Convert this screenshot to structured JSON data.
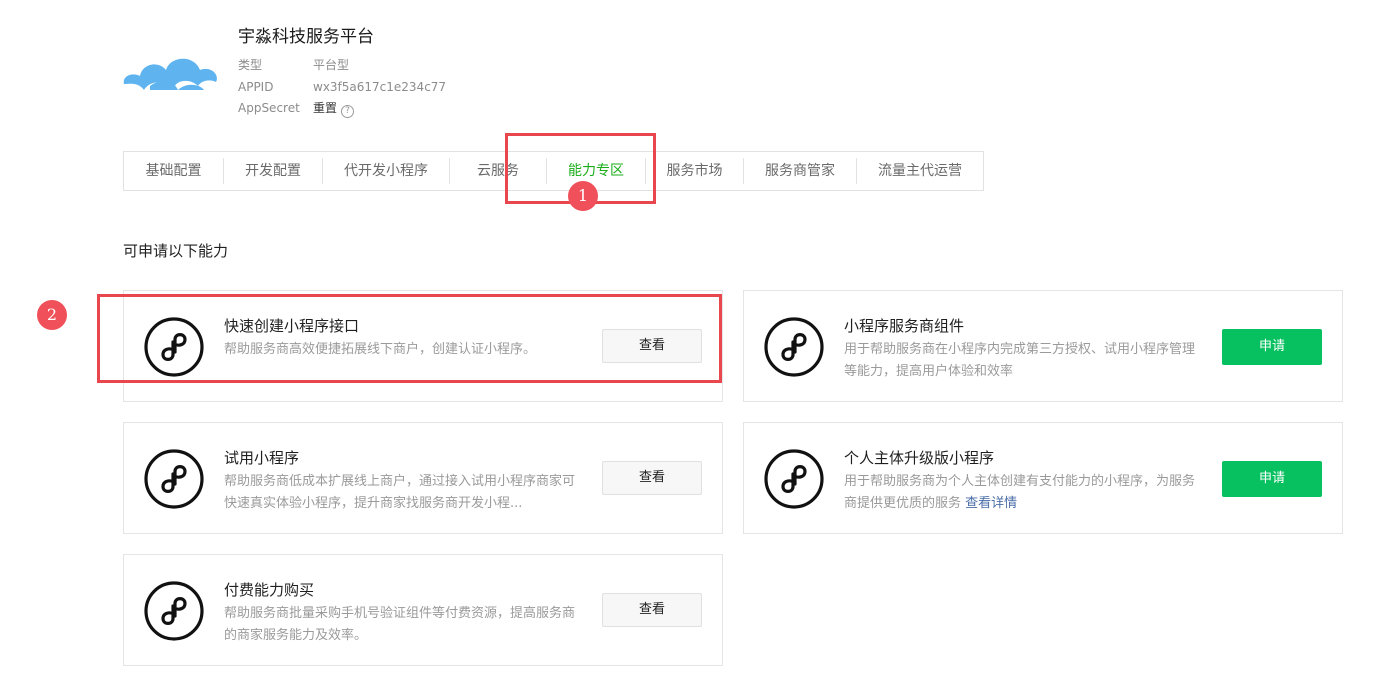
{
  "account": {
    "name": "宇淼科技服务平台",
    "type_label": "类型",
    "type_value": "平台型",
    "appid_label": "APPID",
    "appid_value": "wx3f5a617c1e234c77",
    "secret_label": "AppSecret",
    "secret_action": "重置",
    "help_glyph": "?"
  },
  "tabs": [
    {
      "label": "基础配置",
      "active": false
    },
    {
      "label": "开发配置",
      "active": false
    },
    {
      "label": "代开发小程序",
      "active": false
    },
    {
      "label": "云服务",
      "active": false
    },
    {
      "label": "能力专区",
      "active": true
    },
    {
      "label": "服务市场",
      "active": false
    },
    {
      "label": "服务商管家",
      "active": false
    },
    {
      "label": "流量主代运营",
      "active": false
    }
  ],
  "annotations": {
    "badge_1": "1",
    "badge_2": "2",
    "color": "#e8474e"
  },
  "section_title": "可申请以下能力",
  "cards": [
    {
      "title": "快速创建小程序接口",
      "desc": "帮助服务商高效便捷拓展线下商户，创建认证小程序。",
      "button": "查看",
      "button_type": "view",
      "icon": "mini-program-icon"
    },
    {
      "title": "小程序服务商组件",
      "desc": "用于帮助服务商在小程序内完成第三方授权、试用小程序管理等能力，提高用户体验和效率",
      "button": "申请",
      "button_type": "apply",
      "icon": "mini-program-icon"
    },
    {
      "title": "试用小程序",
      "desc": "帮助服务商低成本扩展线上商户，通过接入试用小程序商家可快速真实体验小程序，提升商家找服务商开发小程...",
      "button": "查看",
      "button_type": "view",
      "icon": "mini-program-icon"
    },
    {
      "title": "个人主体升级版小程序",
      "desc": "用于帮助服务商为个人主体创建有支付能力的小程序，为服务商提供更优质的服务",
      "desc_link": "查看详情",
      "button": "申请",
      "button_type": "apply",
      "icon": "mini-program-icon"
    },
    {
      "title": "付费能力购买",
      "desc": "帮助服务商批量采购手机号验证组件等付费资源，提高服务商的商家服务能力及效率。",
      "button": "查看",
      "button_type": "view",
      "icon": "mini-program-icon"
    }
  ],
  "colors": {
    "accent_green": "#07c160",
    "active_tab": "#1aad19",
    "cloud_logo": "#5fb4f0"
  }
}
